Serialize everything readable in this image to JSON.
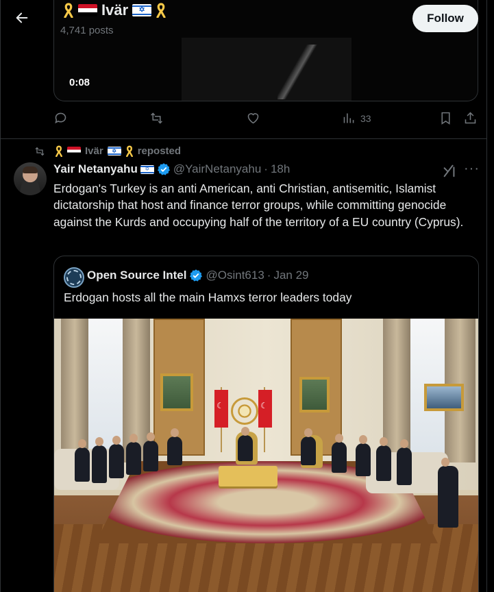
{
  "header": {
    "display_name": "Ivär",
    "posts_count": "4,741 posts",
    "follow_label": "Follow"
  },
  "previous_post": {
    "video_timecode": "0:08",
    "actions": {
      "views": "33"
    }
  },
  "repost": {
    "reposter_name": "Ivär",
    "reposted_label": "reposted"
  },
  "tweet": {
    "name": "Yair Netanyahu",
    "handle": "@YairNetanyahu",
    "separator": "·",
    "time": "18h",
    "text": "Erdogan's Turkey is an anti American, anti Christian, antisemitic, Islamist dictatorship that host and finance terror groups, while committing genocide against the Kurds and occupying half of the territory of a EU country (Cyprus).",
    "more_label": "···"
  },
  "quoted": {
    "name": "Open Source Intel",
    "handle": "@Osint613",
    "separator": "·",
    "date": "Jan 29",
    "text": "Erdogan hosts all the main Hamxs terror leaders today"
  },
  "colors": {
    "background": "#000000",
    "text_primary": "#e7e9ea",
    "text_secondary": "#71767b",
    "border": "#2f3336",
    "verified_blue": "#1d9bf0",
    "ribbon_yellow": "#f7c948"
  },
  "icons": [
    "back-arrow-icon",
    "yellow-ribbon-icon",
    "syria-flag-icon",
    "israel-flag-icon",
    "reply-icon",
    "repost-icon",
    "like-icon",
    "views-icon",
    "bookmark-icon",
    "share-icon",
    "verified-badge-icon",
    "grok-icon",
    "more-icon"
  ]
}
